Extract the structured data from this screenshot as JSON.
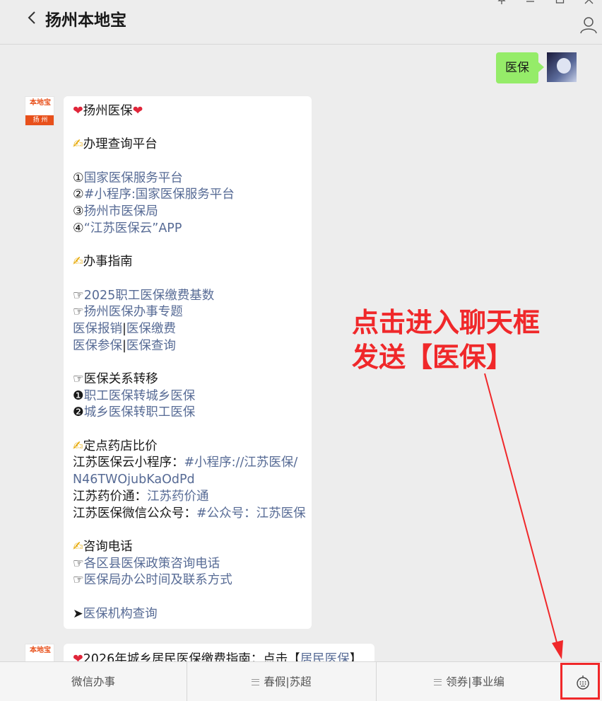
{
  "header": {
    "title": "扬州本地宝",
    "back_icon": "chevron-left-icon",
    "profile_icon": "person-icon",
    "window_controls": [
      "pin-icon",
      "minimize-icon",
      "maximize-icon",
      "close-icon"
    ]
  },
  "user_message": {
    "text": "医保"
  },
  "bot": {
    "avatar_top": "本地宝",
    "avatar_bottom": "扬 州"
  },
  "bot_message": {
    "l1": "扬州医保",
    "l2": "办理查询平台",
    "l3a": "①",
    "l3b": "国家医保服务平台",
    "l4a": "②",
    "l4b": "#小程序:国家医保服务平台",
    "l5a": "③",
    "l5b": "扬州市医保局",
    "l6a": "④",
    "l6b": "“江苏医保云”APP",
    "l7": "办事指南",
    "l8a": "☞",
    "l8b": "2025职工医保缴费基数",
    "l9a": "☞",
    "l9b": "扬州医保办事专题",
    "l10a": "医保报销",
    "l10s": "|",
    "l10b": "医保缴费",
    "l11a": "医保参保",
    "l11s": "|",
    "l11b": "医保查询",
    "l12": "☞医保关系转移",
    "l13a": "❶",
    "l13b": "职工医保转城乡医保",
    "l14a": "❷",
    "l14b": "城乡医保转职工医保",
    "l15": "定点药店比价",
    "l16a": "江苏医保云小程序：",
    "l16b": "#小程序://江苏医保/",
    "l17": "N46TWOjubKaOdPd",
    "l18a": "江苏药价通：",
    "l18b": "江苏药价通",
    "l19a": "江苏医保微信公众号：",
    "l19b": "#公众号：江苏医保",
    "l20": "咨询电话",
    "l21a": "☞",
    "l21b": "各区县医保政策咨询电话",
    "l22a": "☞",
    "l22b": "医保局办公时间及联系方式",
    "l23a": "➤",
    "l23b": "医保机构查询"
  },
  "bot_message2": {
    "text_a": "2026年城乡居民医保缴费指南：点击【",
    "text_b": "居民医保",
    "text_c": "】"
  },
  "annotation": {
    "line1": "点击进入聊天框",
    "line2": "发送【医保】"
  },
  "bottom_menu": {
    "item1": "微信办事",
    "item2": "春假|苏超",
    "item3": "领券|事业编",
    "keyboard_icon": "keyboard-icon"
  },
  "colors": {
    "background": "#ededed",
    "user_bubble": "#95ec69",
    "link": "#576b95",
    "annotation": "#f0282a",
    "brand": "#e8501b"
  }
}
